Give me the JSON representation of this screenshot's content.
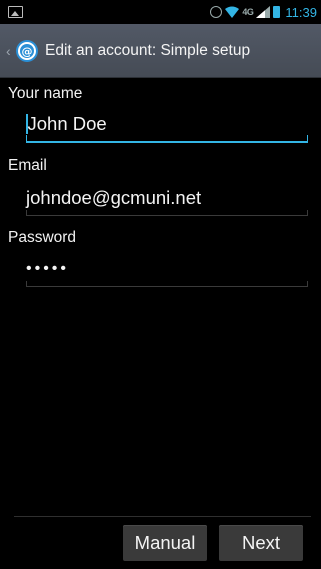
{
  "status_bar": {
    "time": "11:39",
    "network": "4G",
    "accent_color": "#33b5e5"
  },
  "action_bar": {
    "title": "Edit an account: Simple setup",
    "back_icon": "chevron-left-icon",
    "app_icon": "email-at-icon"
  },
  "form": {
    "name_label": "Your name",
    "name_value": "John Doe",
    "email_label": "Email",
    "email_value": "johndoe@gcmuni.net",
    "password_label": "Password",
    "password_value": "•••••"
  },
  "buttons": {
    "manual_label": "Manual",
    "next_label": "Next"
  }
}
